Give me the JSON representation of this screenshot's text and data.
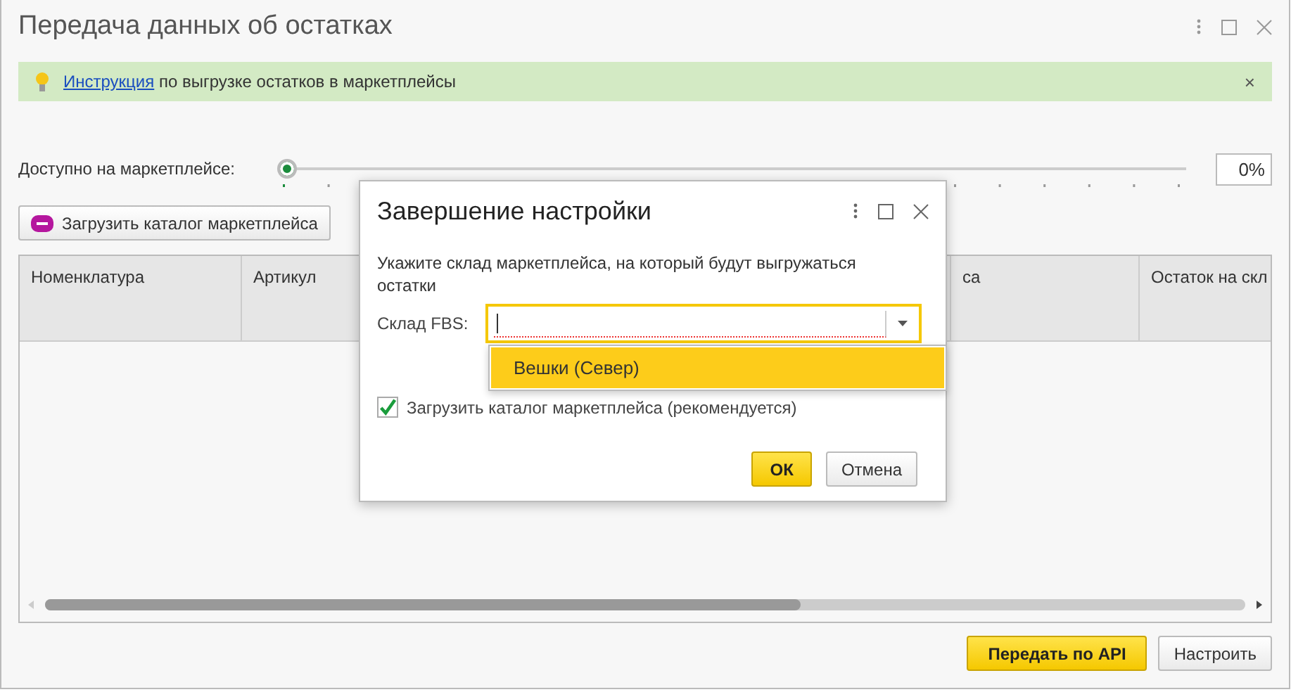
{
  "window": {
    "title": "Передача данных об остатках"
  },
  "banner": {
    "link": "Инструкция",
    "text": "по выгрузке остатков в маркетплейсы",
    "close": "×"
  },
  "availability": {
    "label": "Доступно на маркетплейсе:",
    "level": 0,
    "reading": "0%"
  },
  "load_catalog_button": "Загрузить каталог маркетплейса",
  "table": {
    "columns": [
      {
        "label": "Номенклатура"
      },
      {
        "label": "Артикул"
      },
      {},
      {
        "label": "са"
      },
      {
        "label": "Остаток на скл"
      }
    ]
  },
  "buttons": [
    {
      "label": "Передать по API",
      "kind": "primary"
    },
    {
      "label": "Настроить",
      "kind": "default"
    }
  ],
  "dialog": {
    "title": "Завершение настройки",
    "prompt": "Укажите склад маркетплейса, на который будут выгружаться остатки",
    "field_label": "Склад FBS:",
    "dropdown": [
      {
        "label": "Вешки (Север)",
        "selected": true
      }
    ],
    "checkbox": {
      "label": "Загрузить каталог маркетплейса (рекомендуется)",
      "checked": true
    },
    "buttons": [
      {
        "label": "ОК",
        "kind": "primary"
      },
      {
        "label": "Отмена",
        "kind": "default"
      }
    ]
  }
}
